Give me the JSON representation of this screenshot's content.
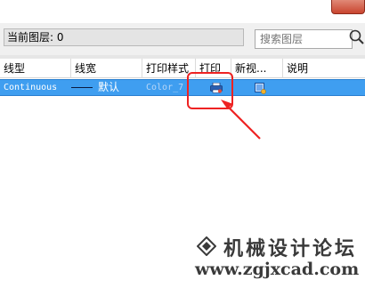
{
  "toolbar": {
    "current_layer_label": "当前图层:",
    "current_layer_value": "0",
    "search_placeholder": "搜索图层"
  },
  "columns": [
    {
      "key": "linetype",
      "label": "线型"
    },
    {
      "key": "lineweight",
      "label": "线宽"
    },
    {
      "key": "plotstyle",
      "label": "打印样式"
    },
    {
      "key": "plot",
      "label": "打印"
    },
    {
      "key": "newvp",
      "label": "新视..."
    },
    {
      "key": "description",
      "label": "说明"
    }
  ],
  "selected_row": {
    "linetype": "Continuous",
    "lineweight": "默认",
    "plotstyle": "Color_7",
    "plot_icon": "printer-icon",
    "newvp_icon": "new-viewport-freeze-icon",
    "description": ""
  },
  "colors": {
    "selection": "#3f9ef0",
    "annotation": "#ee2222"
  },
  "watermark": {
    "name": "机械设计论坛",
    "url": "www.zgjxcad.com"
  }
}
